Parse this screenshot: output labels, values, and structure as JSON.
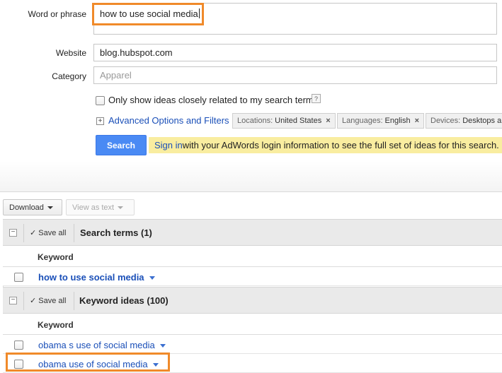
{
  "form": {
    "phrase_label": "Word or phrase",
    "phrase_value": "how to use social media",
    "website_label": "Website",
    "website_value": "blog.hubspot.com",
    "category_label": "Category",
    "category_placeholder": "Apparel",
    "only_related_label": "Only show ideas closely related to my search terms",
    "help_symbol": "?",
    "advanced_link": "Advanced Options and Filters",
    "plus_symbol": "+"
  },
  "filters": [
    {
      "key": "Locations:",
      "value": "United States"
    },
    {
      "key": "Languages:",
      "value": "English"
    },
    {
      "key": "Devices:",
      "value": "Desktops and laptops"
    }
  ],
  "close_symbol": "×",
  "search_button": "Search",
  "notice": {
    "link": "Sign in",
    "text": " with your AdWords login information to see the full set of ideas for this search."
  },
  "toolbar": {
    "download": "Download",
    "view_as_text": "View as text"
  },
  "groups": {
    "search_terms": {
      "save_all": "Save all",
      "title": "Search terms (1)"
    },
    "keyword_ideas": {
      "save_all": "Save all",
      "title": "Keyword ideas (100)"
    }
  },
  "column_header": "Keyword",
  "check_symbol": "✓",
  "minus_symbol": "−",
  "search_terms_rows": [
    "how to use social media"
  ],
  "keyword_idea_rows": [
    "obama s use of social media",
    "obama use of social media"
  ],
  "colors": {
    "highlight": "#f08a2a",
    "link": "#1a4fb8",
    "search_button": "#4a8af4",
    "notice_bg": "#f9eda0"
  }
}
